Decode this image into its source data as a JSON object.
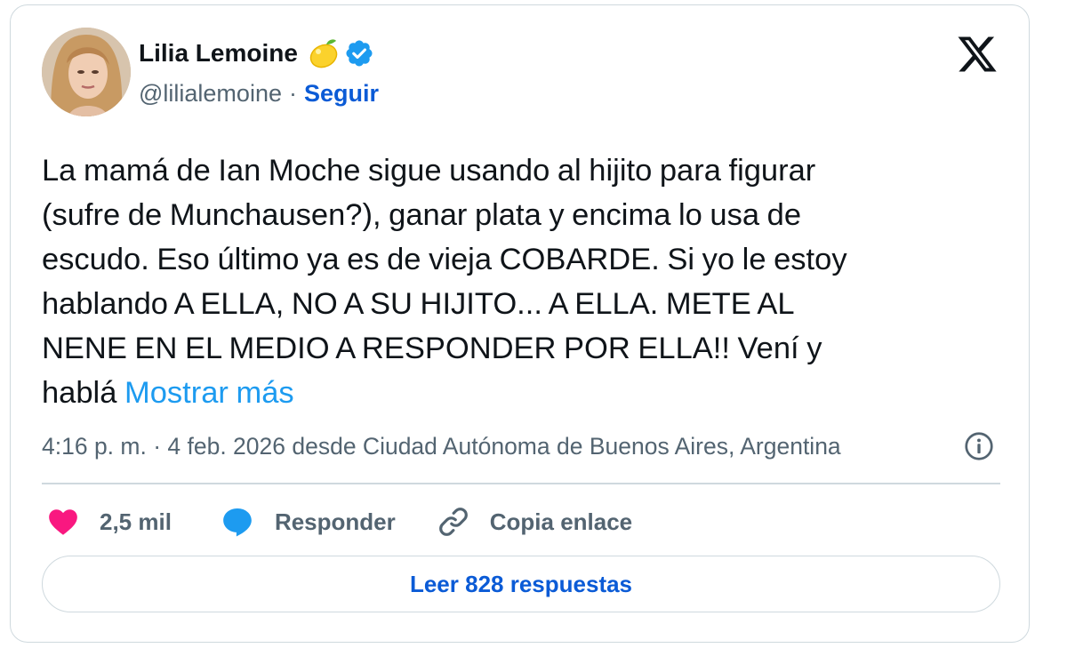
{
  "author": {
    "name": "Lilia Lemoine",
    "handle": "@lilialemoine",
    "separator": "·",
    "follow_label": "Seguir"
  },
  "icons": {
    "emoji": "lemon-icon",
    "verified": "verified-badge-icon",
    "logo": "x-logo-icon",
    "info": "info-icon",
    "like": "heart-icon",
    "reply": "speech-bubble-icon",
    "copy": "link-icon"
  },
  "colors": {
    "accent": "#1d9bf0",
    "follow_blue": "#0b5bd6",
    "heart": "#f91880",
    "text": "#0f1419",
    "secondary": "#536471",
    "border": "#cfd9de"
  },
  "tweet": {
    "text": "La mamá de Ian Moche sigue usando al hijito para figurar\n(sufre de Munchausen?), ganar plata y encima lo usa de\nescudo.  Eso último ya es de vieja COBARDE. Si yo le estoy\nhablando A ELLA, NO A SU HIJITO... A ELLA. METE AL\nNENE EN EL MEDIO A RESPONDER POR ELLA!! Vení y\nhablá ",
    "show_more": "Mostrar más"
  },
  "meta": {
    "text": "4:16 p. m. · 4 feb. 2026 desde Ciudad Autónoma de Buenos Aires, Argentina"
  },
  "actions": {
    "likes_count": "2,5 mil",
    "reply_label": "Responder",
    "copy_label": "Copia enlace"
  },
  "footer": {
    "read_replies_label": "Leer 828 respuestas"
  }
}
